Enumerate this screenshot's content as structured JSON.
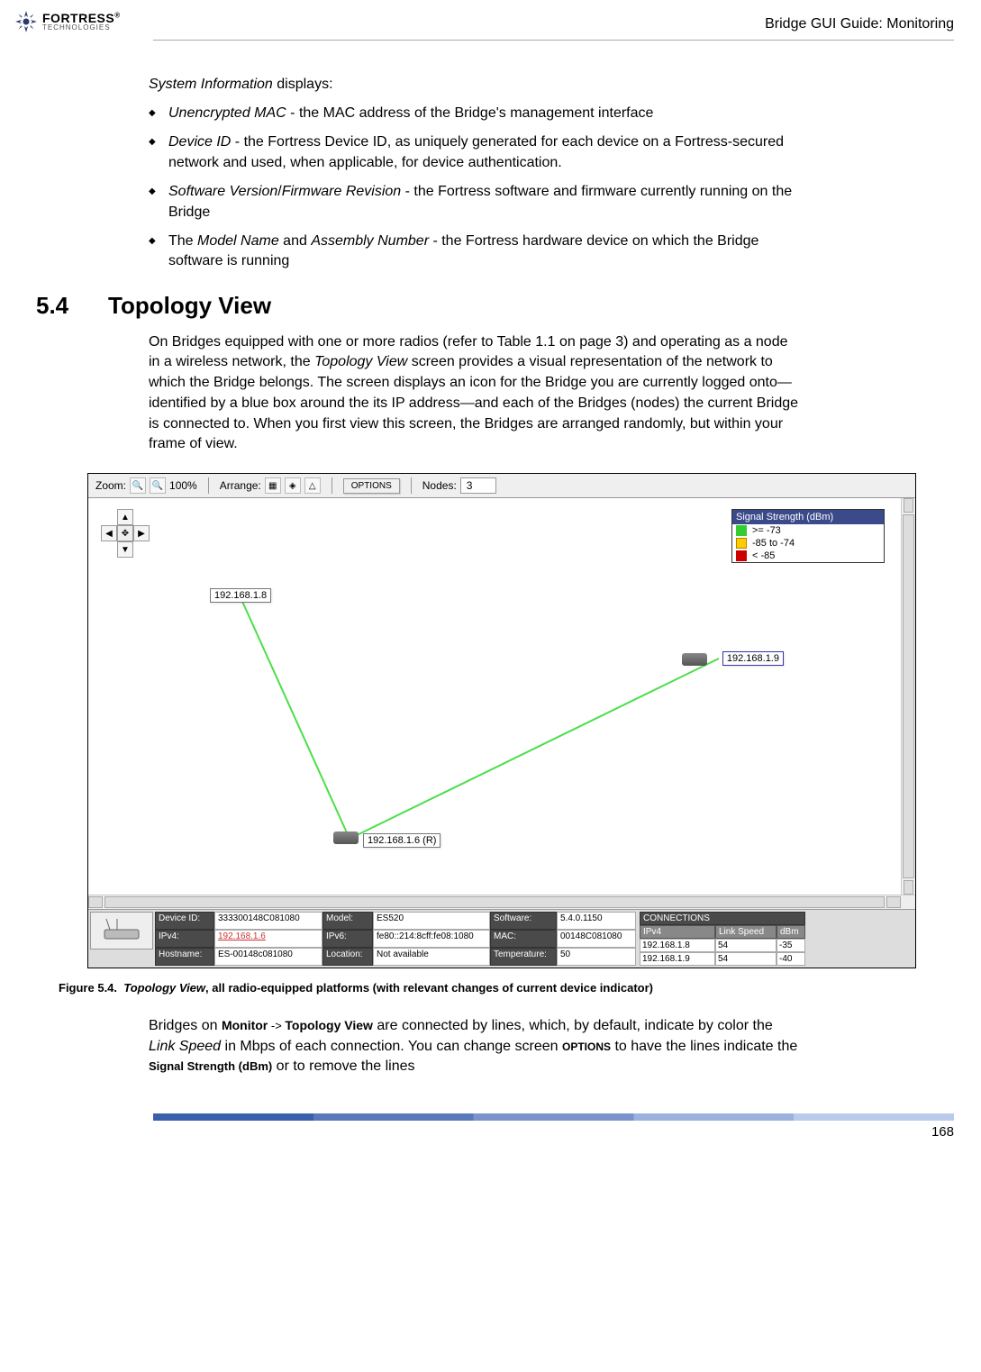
{
  "header": {
    "logo_main": "FORTRESS",
    "logo_sub": "TECHNOLOGIES",
    "right": "Bridge GUI Guide: Monitoring"
  },
  "sysinfo": {
    "lead": "System Information",
    "lead_suffix": " displays:",
    "bullets": [
      {
        "term": "Unencrypted MAC",
        "rest": " - the MAC address of the Bridge's management interface"
      },
      {
        "term": "Device ID",
        "rest": " - the Fortress Device ID, as uniquely generated for each device on a Fortress-secured network and used, when applicable, for device authentication."
      },
      {
        "term": "Software Version",
        "mid": "/",
        "term2": "Firmware Revision",
        "rest": " - the Fortress software and firmware currently running on the Bridge"
      },
      {
        "pre": "The ",
        "term": "Model Name",
        "mid": " and ",
        "term2": "Assembly Number",
        "rest": " - the Fortress hardware device on which the Bridge software is running"
      }
    ]
  },
  "section": {
    "num": "5.4",
    "title": "Topology View",
    "para1_a": "On Bridges equipped with one or more radios (refer to Table 1.1 on page 3) and operating as a node in a wireless network, the ",
    "para1_em": "Topology View",
    "para1_b": " screen provides a visual representation of the network to which the Bridge belongs. The screen displays an icon for the Bridge you are currently logged onto—identified by a blue box around the its IP address—and each of the Bridges (nodes) the current Bridge is connected to. When you first view this screen, the Bridges are arranged randomly, but within your frame of view."
  },
  "topology": {
    "toolbar": {
      "zoom_label": "Zoom:",
      "zoom_val": "100%",
      "arrange_label": "Arrange:",
      "options_btn": "OPTIONS",
      "nodes_label": "Nodes:",
      "nodes_val": "3"
    },
    "legend": {
      "title": "Signal Strength (dBm)",
      "r1": ">= -73",
      "r2": "-85 to -74",
      "r3": "< -85"
    },
    "nodes": {
      "a": "192.168.1.8",
      "b": "192.168.1.9",
      "c": "192.168.1.6 (R)"
    },
    "details": {
      "keys": {
        "device_id": "Device ID:",
        "ipv4": "IPv4:",
        "hostname": "Hostname:",
        "model": "Model:",
        "ipv6": "IPv6:",
        "location": "Location:",
        "software": "Software:",
        "mac": "MAC:",
        "temperature": "Temperature:"
      },
      "vals": {
        "device_id": "333300148C081080",
        "ipv4": "192.168.1.6",
        "hostname": "ES-00148c081080",
        "model": "ES520",
        "ipv6": "fe80::214:8cff:fe08:1080",
        "location": "Not available",
        "software": "5.4.0.1150",
        "mac": "00148C081080",
        "temperature": "50"
      },
      "connections": {
        "title": "CONNECTIONS",
        "cols": {
          "ipv4": "IPv4",
          "link": "Link Speed",
          "dbm": "dBm"
        },
        "rows": [
          {
            "ipv4": "192.168.1.8",
            "link": "54",
            "dbm": "-35"
          },
          {
            "ipv4": "192.168.1.9",
            "link": "54",
            "dbm": "-40"
          }
        ]
      }
    }
  },
  "figure": {
    "label": "Figure 5.4.",
    "title": "Topology View",
    "rest": ", all radio-equipped platforms (with relevant changes of current device indicator)"
  },
  "para2": {
    "a": "Bridges on ",
    "ui1": "Monitor",
    "arrow": " -> ",
    "ui2": "Topology View",
    "b": " are connected by lines, which, by default, indicate by color the ",
    "em1": "Link Speed",
    "c": " in Mbps of each connection. You can change screen ",
    "ui3": "OPTIONS",
    "d": " to have the lines indicate the ",
    "ui4": "Signal Strength (dBm)",
    "e": " or to remove the lines"
  },
  "page_number": "168"
}
